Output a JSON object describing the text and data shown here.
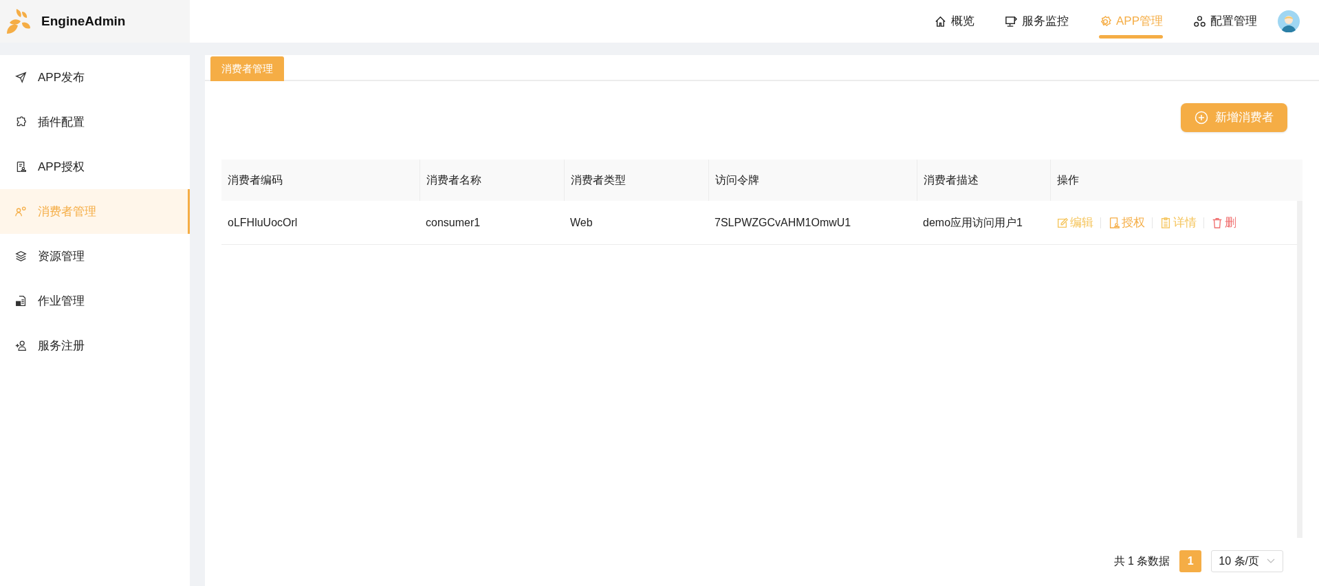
{
  "brand": {
    "name": "EngineAdmin"
  },
  "top_nav": [
    {
      "label": "概览",
      "kind": "home",
      "selected": false
    },
    {
      "label": "服务监控",
      "kind": "monitor",
      "selected": false
    },
    {
      "label": "APP管理",
      "kind": "gear",
      "selected": true
    },
    {
      "label": "配置管理",
      "kind": "circles",
      "selected": false
    }
  ],
  "sidebar": {
    "items": [
      {
        "label": "APP发布",
        "kind": "send",
        "selected": false
      },
      {
        "label": "插件配置",
        "kind": "puzzle",
        "selected": false
      },
      {
        "label": "APP授权",
        "kind": "doc",
        "selected": false
      },
      {
        "label": "消费者管理",
        "kind": "usergear",
        "selected": true
      },
      {
        "label": "资源管理",
        "kind": "layers",
        "selected": false
      },
      {
        "label": "作业管理",
        "kind": "job",
        "selected": false
      },
      {
        "label": "服务注册",
        "kind": "useradd",
        "selected": false
      }
    ]
  },
  "tabs": [
    {
      "label": "消费者管理",
      "selected": true
    }
  ],
  "add_button": {
    "label": "新增消费者"
  },
  "table": {
    "columns": [
      "消费者编码",
      "消费者名称",
      "消费者类型",
      "访问令牌",
      "消费者描述",
      "操作"
    ],
    "rows": [
      {
        "cells": [
          "oLFHluUocOrl",
          "consumer1",
          "Web",
          "7SLPWZGCvAHM1OmwU1",
          "demo应用访问用户1"
        ],
        "actions": [
          {
            "label": "编辑",
            "kind": "edit"
          },
          {
            "label": "授权",
            "kind": "grant"
          },
          {
            "label": "详情",
            "kind": "detail"
          },
          {
            "label": "删",
            "kind": "delete"
          }
        ]
      }
    ]
  },
  "pagination": {
    "total": "共 1 条数据",
    "pages": [
      {
        "label": "1",
        "selected": true
      }
    ],
    "page_size": "10 条/页"
  }
}
